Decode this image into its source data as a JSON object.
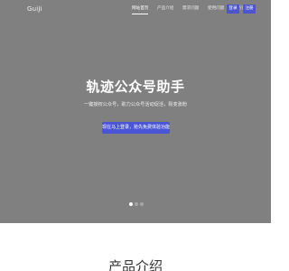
{
  "header": {
    "logo_text": "GuiJi",
    "nav": [
      {
        "label": "网站首页",
        "active": true
      },
      {
        "label": "产品介绍",
        "active": false
      },
      {
        "label": "需求问题",
        "active": false
      },
      {
        "label": "使用问题",
        "active": false
      },
      {
        "label": "服务协议",
        "active": false
      }
    ],
    "login_label": "登录",
    "register_label": "注册"
  },
  "hero": {
    "title": "轨迹公众号助手",
    "subtitle": "一键授权公众号，助力公众号活动促活，裂变涨粉",
    "cta_label": "现在马上登录，抢先免费体验功能",
    "slides": [
      {
        "active": true
      },
      {
        "active": false
      },
      {
        "active": false
      }
    ]
  },
  "section": {
    "title": "产品介绍"
  },
  "colors": {
    "hero_bg": "#808080",
    "accent": "#4a55d6"
  }
}
